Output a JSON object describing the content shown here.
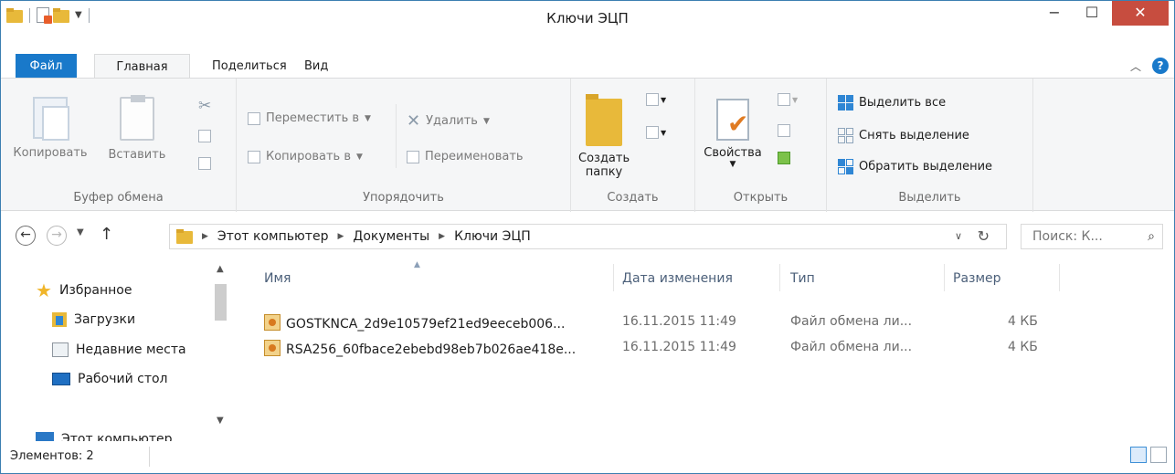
{
  "window": {
    "title": "Ключи ЭЦП",
    "minimize": "−",
    "maximize": "☐",
    "close": "✕"
  },
  "ribbon": {
    "tabs": {
      "file": "Файл",
      "home": "Главная",
      "share": "Поделиться",
      "view": "Вид"
    },
    "clipboard": {
      "copy": "Копировать",
      "paste": "Вставить",
      "group": "Буфер обмена"
    },
    "organize": {
      "move_to": "Переместить в",
      "copy_to": "Копировать в",
      "delete": "Удалить",
      "rename": "Переименовать",
      "group": "Упорядочить"
    },
    "create": {
      "new_folder_line1": "Создать",
      "new_folder_line2": "папку",
      "group": "Создать"
    },
    "open": {
      "properties": "Свойства",
      "group": "Открыть"
    },
    "select": {
      "select_all": "Выделить все",
      "select_none": "Снять выделение",
      "invert": "Обратить выделение",
      "group": "Выделить"
    }
  },
  "address": {
    "breadcrumb": [
      "Этот компьютер",
      "Документы",
      "Ключи ЭЦП"
    ],
    "search_placeholder": "Поиск: К..."
  },
  "nav": {
    "favorites": "Избранное",
    "downloads": "Загрузки",
    "recent": "Недавние места",
    "desktop": "Рабочий стол",
    "this_pc": "Этот компьютер"
  },
  "columns": {
    "name": "Имя",
    "date": "Дата изменения",
    "type": "Тип",
    "size": "Размер"
  },
  "files": [
    {
      "name": "GOSTKNCA_2d9e10579ef21ed9eeceb006...",
      "date": "16.11.2015 11:49",
      "type": "Файл обмена ли...",
      "size": "4 КБ"
    },
    {
      "name": "RSA256_60fbace2ebebd98eb7b026ae418e...",
      "date": "16.11.2015 11:49",
      "type": "Файл обмена ли...",
      "size": "4 КБ"
    }
  ],
  "status": {
    "items": "Элементов: 2"
  },
  "colors": {
    "accent": "#1979ca",
    "close": "#c74d3f",
    "folder": "#e8b93a"
  }
}
